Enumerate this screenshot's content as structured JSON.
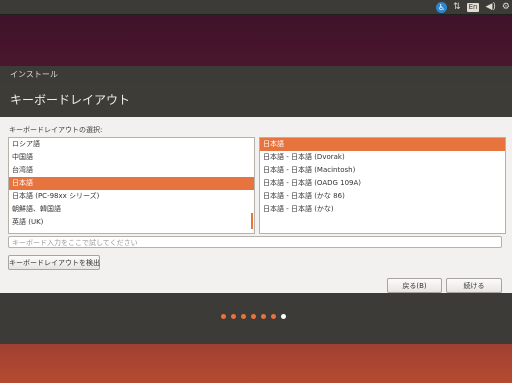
{
  "topbar": {
    "lang_indicator": "En",
    "icons": [
      "accessibility-icon",
      "network-icon",
      "keyboard-language-icon",
      "volume-icon",
      "settings-gear-icon"
    ]
  },
  "window": {
    "title": "インストール",
    "header": "キーボードレイアウト"
  },
  "content": {
    "list_label": "キーボードレイアウトの選択:",
    "languages": [
      {
        "label": "ロシア語",
        "selected": false
      },
      {
        "label": "中国語",
        "selected": false
      },
      {
        "label": "台湾語",
        "selected": false
      },
      {
        "label": "日本語",
        "selected": true
      },
      {
        "label": "日本語 (PC-98xx シリーズ)",
        "selected": false
      },
      {
        "label": "朝鮮語、韓国語",
        "selected": false
      },
      {
        "label": "英語 (UK)",
        "selected": false
      }
    ],
    "variants": [
      {
        "label": "日本語",
        "selected": true
      },
      {
        "label": "日本語 - 日本語 (Dvorak)",
        "selected": false
      },
      {
        "label": "日本語 - 日本語 (Macintosh)",
        "selected": false
      },
      {
        "label": "日本語 - 日本語 (OADG 109A)",
        "selected": false
      },
      {
        "label": "日本語 - 日本語 (かな 86)",
        "selected": false
      },
      {
        "label": "日本語 - 日本語 (かな)",
        "selected": false
      }
    ],
    "test_input_placeholder": "キーボード入力をここで試してください",
    "detect_button": "キーボードレイアウトを検出"
  },
  "buttons": {
    "back": "戻る(B)",
    "continue": "続ける"
  },
  "progress": {
    "total_steps": 7,
    "current_step": 7
  },
  "colors": {
    "accent": "#e7743f",
    "panel": "#3c3b37"
  }
}
